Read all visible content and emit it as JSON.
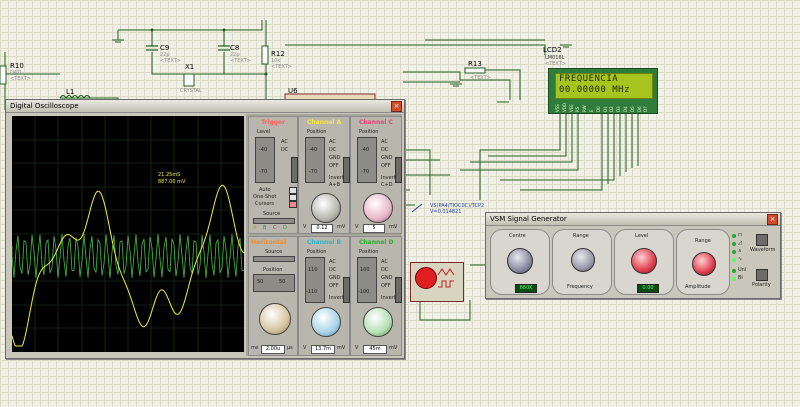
{
  "schematic": {
    "c9": {
      "name": "C9",
      "value": "22p",
      "text": "<TEXT>"
    },
    "c8": {
      "name": "C8",
      "value": "22p",
      "text": "<TEXT>"
    },
    "x1": {
      "name": "X1",
      "value": "CRYSTAL"
    },
    "r12": {
      "name": "R12",
      "value": "10k",
      "text": "<TEXT>"
    },
    "r10": {
      "name": "R10",
      "value": "DATI",
      "text": "<TEXT>"
    },
    "l1": {
      "name": "L1"
    },
    "u6": {
      "name": "U6"
    },
    "r13": {
      "name": "R13",
      "text": "<TEXT>"
    },
    "probe": {
      "line1": "VS(PA4/TIOC0C)/TCP2",
      "line2": "V=0.014821"
    }
  },
  "lcd": {
    "name": "LCD2",
    "model": "LM016L",
    "text": "<TEXT>",
    "line1": "FREQUENCIA",
    "line2": "00.00000 MHz",
    "pins": [
      "VSS",
      "VDD",
      "VEE",
      "RS",
      "RW",
      "E",
      "D0",
      "D1",
      "D2",
      "D3",
      "D4",
      "D5",
      "D6",
      "D7"
    ]
  },
  "oscilloscope": {
    "title": "Digital Oscilloscope",
    "close": "×",
    "cursor_readout": {
      "time": "21.25mS",
      "value": "887.00 mV"
    },
    "trigger": {
      "title": "Trigger",
      "level_label": "Level",
      "level_ticks": [
        "-40",
        "-70"
      ],
      "coupling": [
        "AC",
        "DC"
      ],
      "modes": [
        "Auto",
        "One-Shot",
        "Cursors"
      ],
      "source_label": "Source",
      "sources": [
        "A",
        "B",
        "C",
        "D"
      ]
    },
    "channel_a": {
      "title": "Channel A",
      "position_label": "Position",
      "ticks": [
        "-40",
        "-70"
      ],
      "coupling": [
        "AC",
        "DC",
        "GND",
        "OFF"
      ],
      "invert": "Invert",
      "mix": "A+B",
      "readout": "0.12",
      "unit": "mV",
      "vlabel": "V"
    },
    "channel_c": {
      "title": "Channel C",
      "position_label": "Position",
      "ticks": [
        "-40",
        "-70"
      ],
      "coupling": [
        "AC",
        "DC",
        "GND",
        "OFF"
      ],
      "invert": "Invert",
      "mix": "C+D",
      "readout": "5",
      "unit": "mV",
      "vlabel": "V"
    },
    "horizontal": {
      "title": "Horizontal",
      "source_label": "Source",
      "position_label": "Position",
      "ticks": [
        "50",
        "50"
      ],
      "readout": "2.00u",
      "units_left": "ms",
      "units_right": "µs"
    },
    "channel_b": {
      "title": "Channel B",
      "position_label": "Position",
      "ticks": [
        "110",
        "-110"
      ],
      "coupling": [
        "AC",
        "DC",
        "GND",
        "OFF"
      ],
      "invert": "Invert",
      "readout": "13.7m",
      "unit": "mV",
      "vlabel": "V"
    },
    "channel_d": {
      "title": "Channel D",
      "position_label": "Position",
      "ticks": [
        "100",
        "-100"
      ],
      "coupling": [
        "AC",
        "DC",
        "GND",
        "OFF"
      ],
      "invert": "Invert",
      "readout": "45m",
      "unit": "mV",
      "vlabel": "V"
    },
    "colors": {
      "channel_a": "#f5e840",
      "channel_b": "#2fb58a",
      "channel_c": "#e0457a",
      "channel_d": "#4ec94e",
      "trigger": "#ff6060",
      "horizontal": "#f08a2a"
    }
  },
  "signal_generator": {
    "title": "VSM Signal Generator",
    "close": "×",
    "centre": {
      "label": "Centre",
      "ticks": [
        "5",
        "6",
        "7",
        "8",
        "9",
        "10",
        "11",
        "12",
        "4",
        "3",
        "2",
        "1",
        "0"
      ],
      "readout": "680K"
    },
    "range_freq": {
      "label": "Range",
      "ticks": [
        "1k",
        "10k",
        "100",
        "1m",
        "10",
        "0.1",
        "1"
      ],
      "caption": "Frequency"
    },
    "level": {
      "label": "Level",
      "ticks": [
        "4",
        "5",
        "6",
        "7",
        "8",
        "9",
        "10",
        "11",
        "12",
        "3",
        "2",
        "1",
        "0"
      ],
      "readout": "0.00"
    },
    "range_amp": {
      "label": "Range",
      "ticks": [
        "10",
        "0.1",
        "1",
        "1m"
      ],
      "caption": "Amplitude"
    },
    "waveform_button": "Waveform",
    "polarity_button": "Polarity",
    "polarity_labels": [
      "Uni",
      "Bi"
    ],
    "waveform_icons": [
      "square-wave-icon",
      "sawtooth-icon",
      "triangle-icon",
      "sine-icon"
    ]
  }
}
